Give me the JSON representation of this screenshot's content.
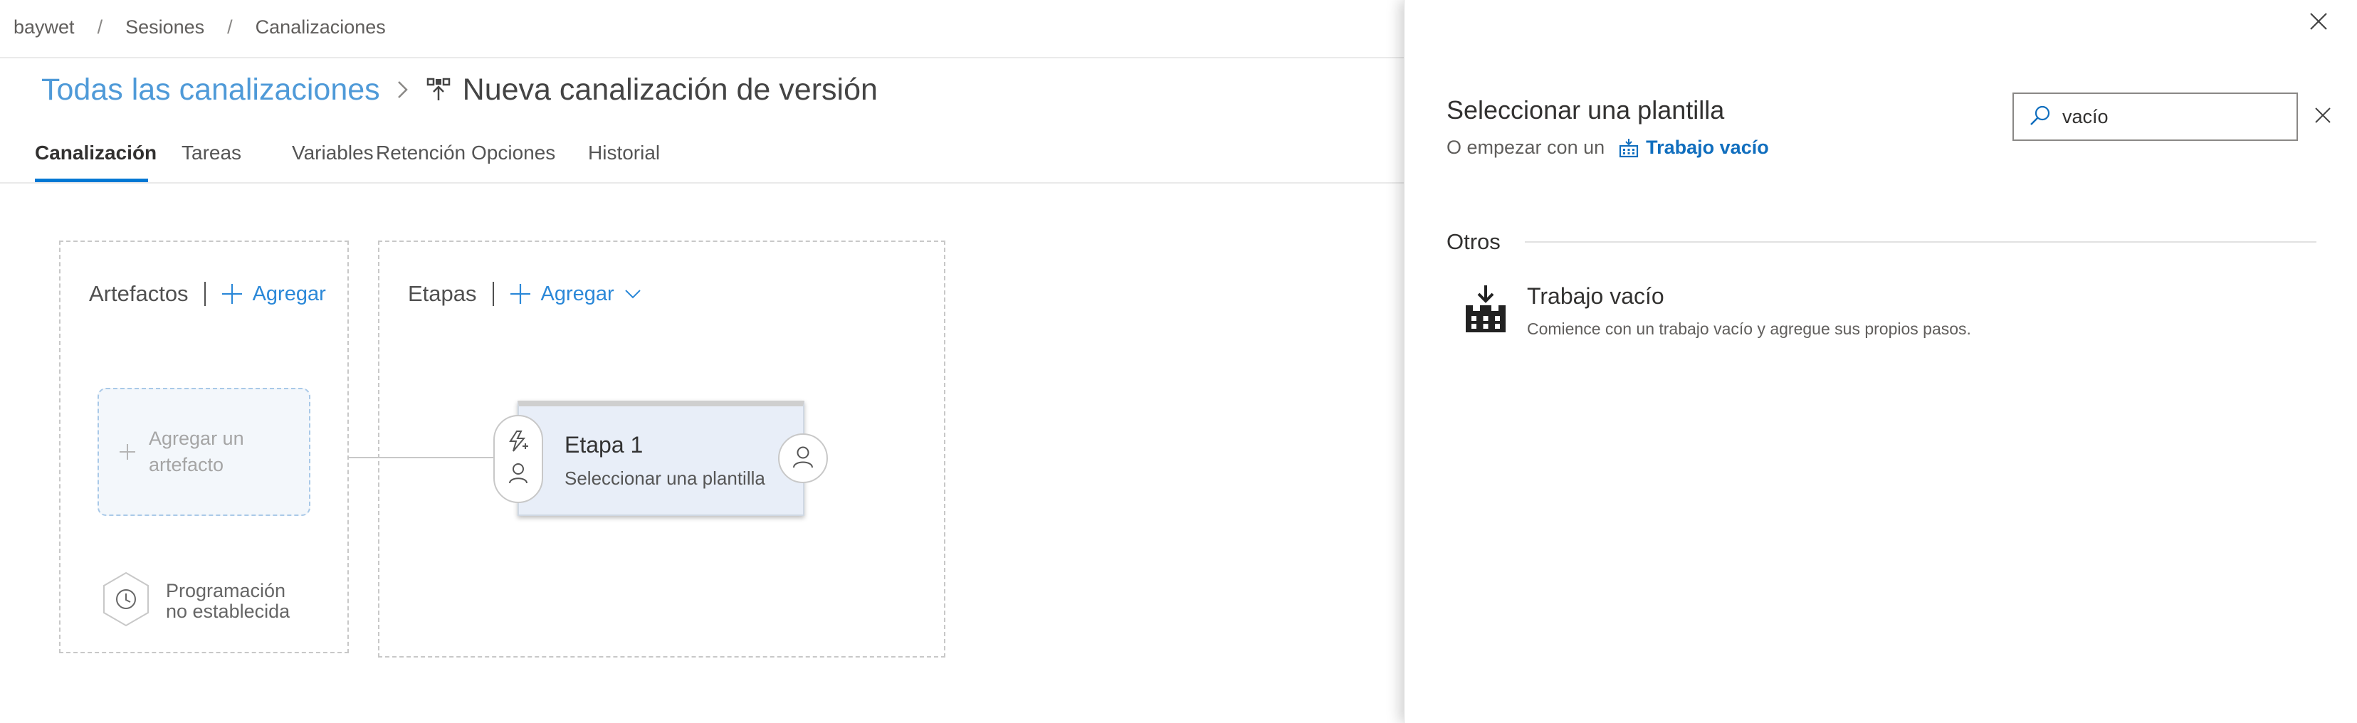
{
  "breadcrumb": {
    "items": [
      "baywet",
      "Sesiones",
      "Canalizaciones"
    ]
  },
  "header": {
    "all_pipelines_link": "Todas las canalizaciones",
    "pipeline_title": "Nueva canalización de versión"
  },
  "tabs": [
    {
      "label": "Canalización",
      "active": true
    },
    {
      "label": "Tareas"
    },
    {
      "label": "Variables"
    },
    {
      "label": "Retención"
    },
    {
      "label": "Opciones"
    },
    {
      "label": "Historial"
    }
  ],
  "artifacts": {
    "heading": "Artefactos",
    "add_label": "Agregar",
    "add_artifact_text": "Agregar un artefacto",
    "schedule_text_line1": "Programación",
    "schedule_text_line2": "no establecida"
  },
  "stages": {
    "heading": "Etapas",
    "add_label": "Agregar",
    "stage": {
      "name": "Etapa 1",
      "subtitle": "Seleccionar una plantilla"
    }
  },
  "panel": {
    "title": "Seleccionar una plantilla",
    "start_prefix": "O empezar con un",
    "empty_job_link": "Trabajo vacío",
    "search_value": "vacío",
    "group_label": "Otros",
    "templates": [
      {
        "name": "Trabajo vacío",
        "description": "Comience con un trabajo vacío y agregue sus propios pasos."
      }
    ]
  },
  "colors": {
    "accent": "#0078d4",
    "link": "#4f9ad8",
    "stage_bg": "#e8eef8"
  },
  "icons": {
    "close": "close-icon",
    "search": "search-icon",
    "clear": "clear-search-icon",
    "pipeline": "release-pipeline-icon",
    "factory": "factory-icon",
    "empty_job": "empty-job-download-icon",
    "trigger": "lightning-icon",
    "user": "user-icon",
    "clock": "clock-icon",
    "plus": "plus-icon",
    "chevron": "chevron-down-icon"
  }
}
